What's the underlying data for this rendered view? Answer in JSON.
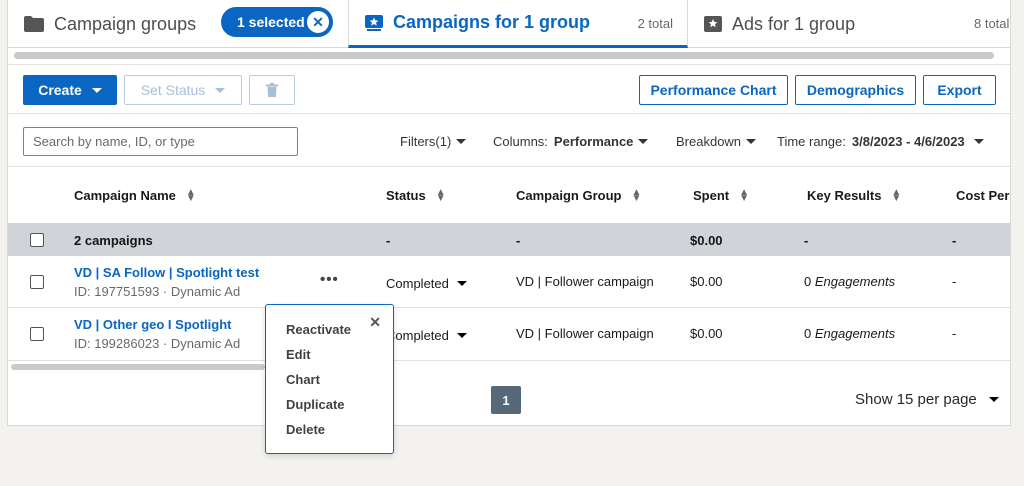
{
  "tabs": {
    "groups_label": "Campaign groups",
    "selected_pill": "1 selected",
    "campaigns_label": "Campaigns for 1 group",
    "campaigns_count": "2 total",
    "ads_label": "Ads for 1 group",
    "ads_count": "8 total"
  },
  "toolbar": {
    "create_label": "Create",
    "set_status_label": "Set Status",
    "performance_chart_label": "Performance Chart",
    "demographics_label": "Demographics",
    "export_label": "Export"
  },
  "filters": {
    "search_placeholder": "Search by name, ID, or type",
    "filters_label": "Filters(1)",
    "columns_label": "Columns:",
    "columns_value": "Performance",
    "breakdown_label": "Breakdown",
    "time_range_label": "Time range:",
    "time_range_value": "3/8/2023 - 4/6/2023"
  },
  "table": {
    "headers": {
      "name": "Campaign Name",
      "status": "Status",
      "group": "Campaign Group",
      "spent": "Spent",
      "key_results": "Key Results",
      "cost_per": "Cost Per"
    },
    "total": {
      "name": "2 campaigns",
      "status": "-",
      "group": "-",
      "spent": "$0.00",
      "key_results": "-",
      "cost_per": "-"
    },
    "rows": [
      {
        "name": "VD | SA Follow | Spotlight test",
        "meta": "ID: 197751593 · Dynamic Ad",
        "status": "Completed",
        "group": "VD | Follower campaign",
        "spent": "$0.00",
        "key_results_count": "0",
        "key_results_type": "Engagements",
        "cost_per": "-"
      },
      {
        "name": "VD | Other geo I Spotlight",
        "meta": "ID: 199286023 · Dynamic Ad",
        "status": "Completed",
        "group": "VD | Follower campaign",
        "spent": "$0.00",
        "key_results_count": "0",
        "key_results_type": "Engagements",
        "cost_per": "-"
      }
    ]
  },
  "menu": {
    "items": [
      "Reactivate",
      "Edit",
      "Chart",
      "Duplicate",
      "Delete"
    ]
  },
  "pagination": {
    "current_page": "1",
    "per_page_label": "Show 15 per page"
  },
  "icons": {
    "row_actions": "•••",
    "close": "✕"
  },
  "colors": {
    "accent": "#0a66c2",
    "total_row": "#d0d3d7",
    "page_active": "#56687a"
  }
}
